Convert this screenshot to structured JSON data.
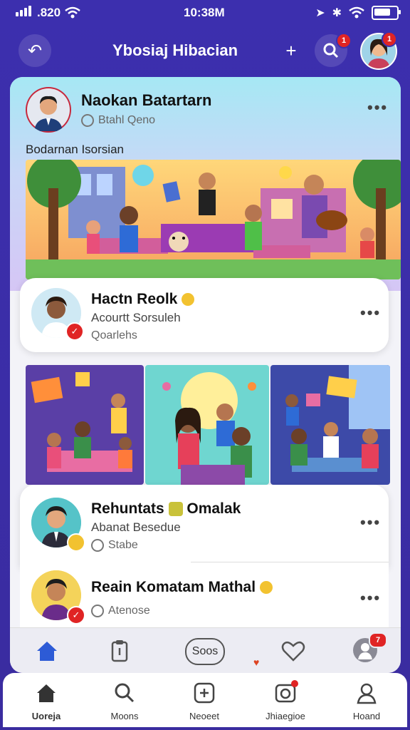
{
  "status": {
    "signal": ".820",
    "time": "10:38M"
  },
  "header": {
    "title": "Ybosiaj Hibacian",
    "search_badge": "1",
    "profile_badge": "1"
  },
  "post1": {
    "name": "Naokan Batartarn",
    "handle": "Btahl Qeno",
    "caption": "Bodarnan Isorsian"
  },
  "card1": {
    "name": "Hactn Reolk",
    "subtitle": "Acourtt Sorsuleh",
    "meta": "Qoarlehs"
  },
  "card2": {
    "name": "Rehuntats",
    "name2": "Omalak",
    "subtitle": "Abanat Besedue",
    "meta": "Stabe"
  },
  "card3": {
    "name": "Reain Komatam Mathal",
    "meta": "Atenose"
  },
  "inner_nav": {
    "pill": "Soos",
    "badge": "7"
  },
  "bottom_nav": [
    {
      "label": "Uoreja"
    },
    {
      "label": "Moons"
    },
    {
      "label": "Neoeet"
    },
    {
      "label": "Jhiaegioe"
    },
    {
      "label": "Hoand"
    }
  ],
  "colors": {
    "accent": "#3c2fae",
    "badge": "#e02424",
    "home": "#2d5bd6"
  }
}
